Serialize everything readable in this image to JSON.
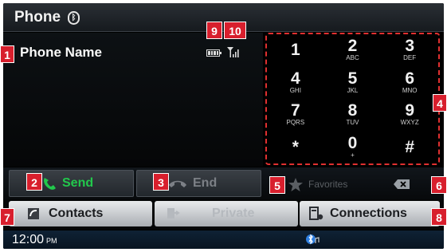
{
  "header": {
    "title": "Phone",
    "bt_icon": "bluetooth-icon"
  },
  "info": {
    "phone_name": "Phone Name",
    "battery_icon": "battery-icon",
    "signal_icon": "signal-icon"
  },
  "keypad": {
    "keys": [
      {
        "digit": "1",
        "letters": ""
      },
      {
        "digit": "2",
        "letters": "ABC"
      },
      {
        "digit": "3",
        "letters": "DEF"
      },
      {
        "digit": "4",
        "letters": "GHI"
      },
      {
        "digit": "5",
        "letters": "JKL"
      },
      {
        "digit": "6",
        "letters": "MNO"
      },
      {
        "digit": "7",
        "letters": "PQRS"
      },
      {
        "digit": "8",
        "letters": "TUV"
      },
      {
        "digit": "9",
        "letters": "WXYZ"
      },
      {
        "digit": "*",
        "letters": ""
      },
      {
        "digit": "0",
        "letters": "+"
      },
      {
        "digit": "#",
        "letters": ""
      }
    ]
  },
  "callbar": {
    "send_label": "Send",
    "end_label": "End",
    "favorites_label": "Favorites"
  },
  "funcbar": {
    "contacts_label": "Contacts",
    "private_label": "Private",
    "connections_label": "Connections"
  },
  "status": {
    "time": "12:00",
    "ampm": "PM"
  },
  "callouts": [
    "1",
    "2",
    "3",
    "4",
    "5",
    "6",
    "7",
    "8",
    "9",
    "10"
  ],
  "colors": {
    "accent_green": "#22c84c",
    "callout_red": "#d81f2d",
    "keypad_border": "#e13030"
  }
}
